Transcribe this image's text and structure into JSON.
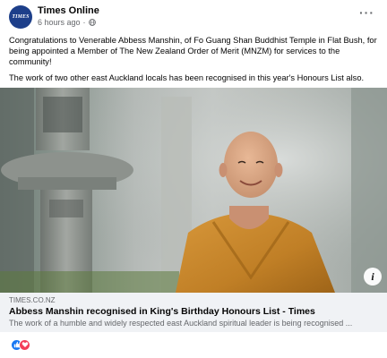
{
  "post": {
    "page_name": "Times Online",
    "time": "6 hours ago",
    "avatar_text": "TIMES",
    "caption_paragraphs": [
      "Congratulations to Venerable Abbess Manshin, of Fo Guang Shan Buddhist Temple in Flat Bush, for being appointed a Member of The New Zealand Order of Merit (MNZM) for services to the community!",
      "The work of two other east Auckland locals has been recognised in this year's Honours List also."
    ]
  },
  "link": {
    "domain": "TIMES.CO.NZ",
    "title": "Abbess Manshin recognised in King's Birthday Honours List - Times",
    "description": "The work of a humble and widely respected east Auckland spiritual leader is being recognised ..."
  },
  "icons": {
    "more": "more-options-icon",
    "globe": "globe-icon",
    "info": "info-icon",
    "like": "like-reaction-icon",
    "love": "love-reaction-icon"
  },
  "colors": {
    "facebook_blue": "#1877f2",
    "love_red": "#f33e58",
    "robe": "#c8862c",
    "link_box": "#f0f2f5"
  }
}
